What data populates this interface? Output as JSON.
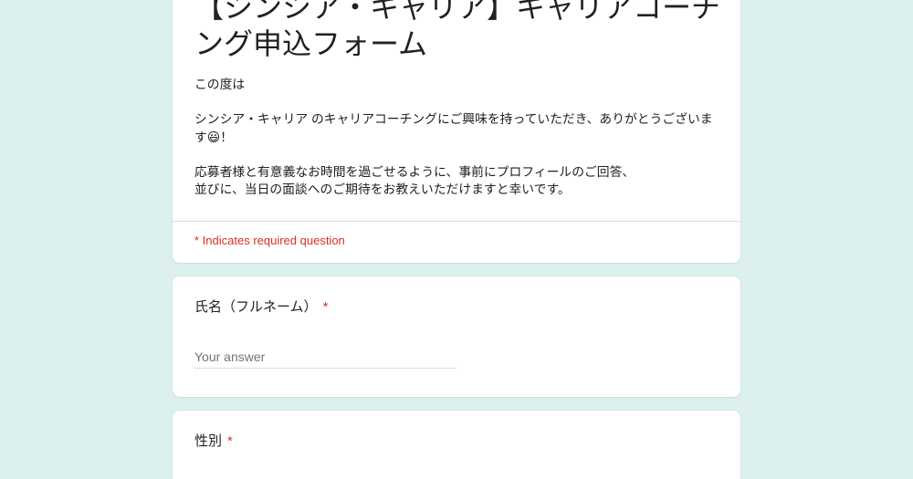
{
  "form": {
    "title": "【シンシア・キャリア】キャリアコーチング申込フォーム",
    "description": "この度は\n\nシンシア・キャリア のキャリアコーチングにご興味を持っていただき、ありがとうございます😃！\n\n応募者様と有意義なお時間を過ごせるように、事前にプロフィールのご回答、\n並びに、当日の面談へのご期待をお教えいただけますと幸いです。",
    "required_notice": "* Indicates required question"
  },
  "questions": [
    {
      "label": "氏名（フルネーム）",
      "required_mark": "*",
      "answer_placeholder": "Your answer"
    },
    {
      "label": "性別",
      "required_mark": "*"
    }
  ],
  "colors": {
    "background": "#dcf0ee",
    "card": "#ffffff",
    "text": "#202124",
    "required": "#d93025",
    "placeholder": "#70757a",
    "divider": "#dadce0"
  }
}
